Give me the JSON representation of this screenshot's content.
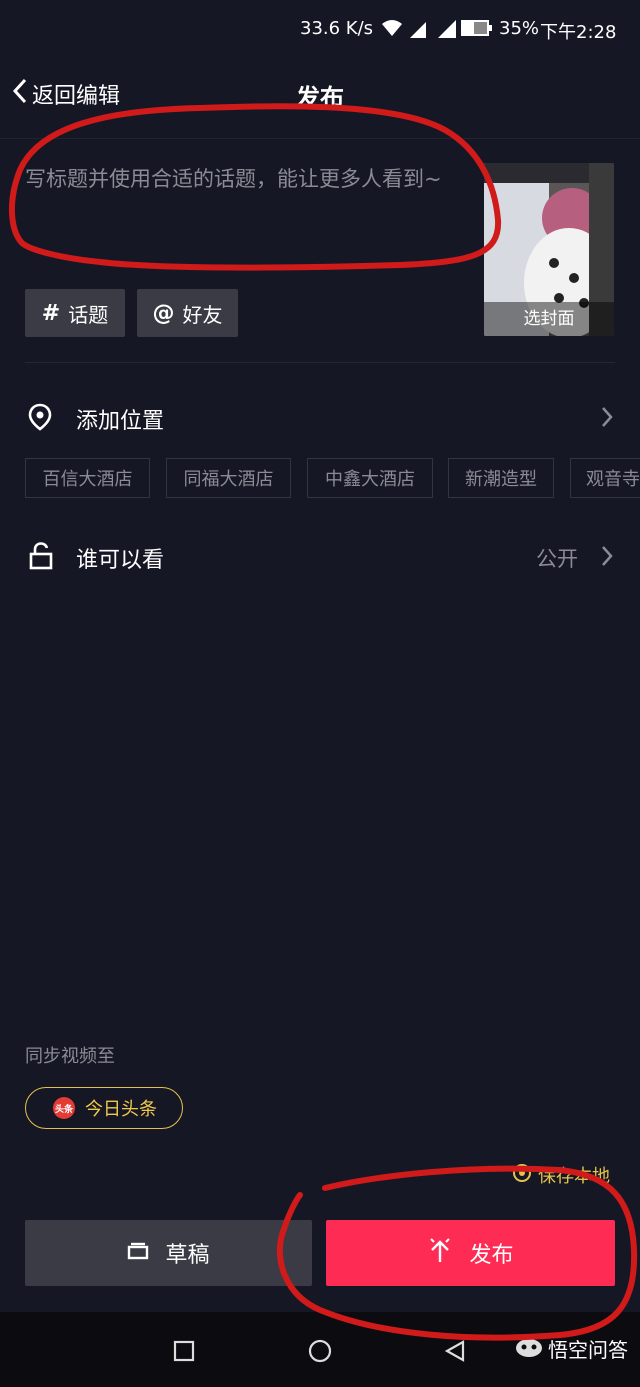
{
  "status": {
    "speed": "33.6 K/s",
    "battery": "35%",
    "time": "下午2:28"
  },
  "header": {
    "back_label": "返回编辑",
    "title": "发布"
  },
  "caption": {
    "placeholder": "写标题并使用合适的话题，能让更多人看到~"
  },
  "cover": {
    "label": "选封面"
  },
  "chips": {
    "topic": "话题",
    "friends": "好友"
  },
  "location": {
    "label": "添加位置",
    "suggestions": [
      "百信大酒店",
      "同福大酒店",
      "中鑫大酒店",
      "新潮造型",
      "观音寺"
    ]
  },
  "visibility": {
    "label": "谁可以看",
    "value": "公开"
  },
  "sync": {
    "label": "同步视频至",
    "target": "今日头条",
    "logo_text": "头条"
  },
  "save_local": "保存本地",
  "buttons": {
    "draft": "草稿",
    "publish": "发布"
  },
  "watermark": "悟空问答",
  "colors": {
    "background": "#161724",
    "publish": "#fe2c55",
    "draft": "#3a3b45",
    "accent_gold": "#e5c14a",
    "annotation_red": "#d11a1a"
  },
  "icons": [
    "signal-icon",
    "battery-icon",
    "back-chevron-icon",
    "hash-icon",
    "at-icon",
    "location-pin-icon",
    "chevron-right-icon",
    "unlock-icon",
    "draft-icon",
    "publish-arrow-icon",
    "nav-square-icon",
    "nav-circle-icon",
    "nav-triangle-icon"
  ]
}
